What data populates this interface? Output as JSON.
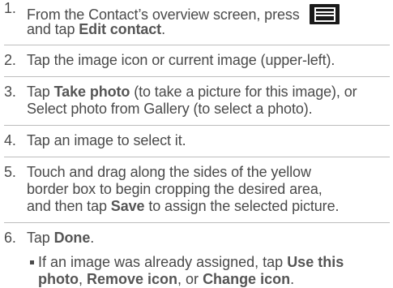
{
  "steps": [
    {
      "num": "1.",
      "t1": "From the Contact’s overview screen, press",
      "t2": "and tap ",
      "b1": "Edit contact",
      "t3": ".",
      "icon": "menu-key-icon"
    },
    {
      "num": "2.",
      "t1": "Tap the image icon or current image (upper-left)."
    },
    {
      "num": "3.",
      "t1": "Tap ",
      "b1": "Take photo",
      "t2": " (to take a picture for this image), or",
      "t3": "Select photo from Gallery (to select a photo)."
    },
    {
      "num": "4.",
      "t1": "Tap an image to select it."
    },
    {
      "num": "5.",
      "t1": "Touch and drag along the sides of the yellow",
      "t2": "border box to begin cropping the desired area,",
      "t3": "and then tap ",
      "b1": "Save",
      "t4": " to assign the selected picture."
    },
    {
      "num": "6.",
      "t1": "Tap ",
      "b1": "Done",
      "t2": "."
    }
  ],
  "sub_bullet": {
    "t1": "If an image was already assigned, tap ",
    "b1": "Use this",
    "b2": "photo",
    "t2": ", ",
    "b3": "Remove icon",
    "t3": ", or ",
    "b4": "Change icon",
    "t4": "."
  }
}
